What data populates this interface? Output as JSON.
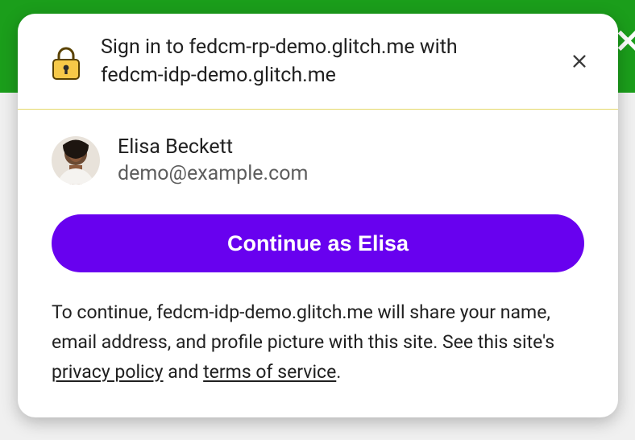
{
  "header": {
    "title_line1": "Sign in to fedcm-rp-demo.glitch.me with",
    "title_line2": "fedcm-idp-demo.glitch.me"
  },
  "account": {
    "name": "Elisa Beckett",
    "email": "demo@example.com"
  },
  "continue_label": "Continue as Elisa",
  "disclosure": {
    "pre": "To continue, fedcm-idp-demo.glitch.me will share your name, email address, and profile picture with this site. See this site's ",
    "privacy_label": "privacy policy",
    "mid": " and ",
    "terms_label": "terms of service",
    "post": "."
  },
  "colors": {
    "brand_green": "#1b9e1b",
    "accent_purple": "#6801ef"
  }
}
